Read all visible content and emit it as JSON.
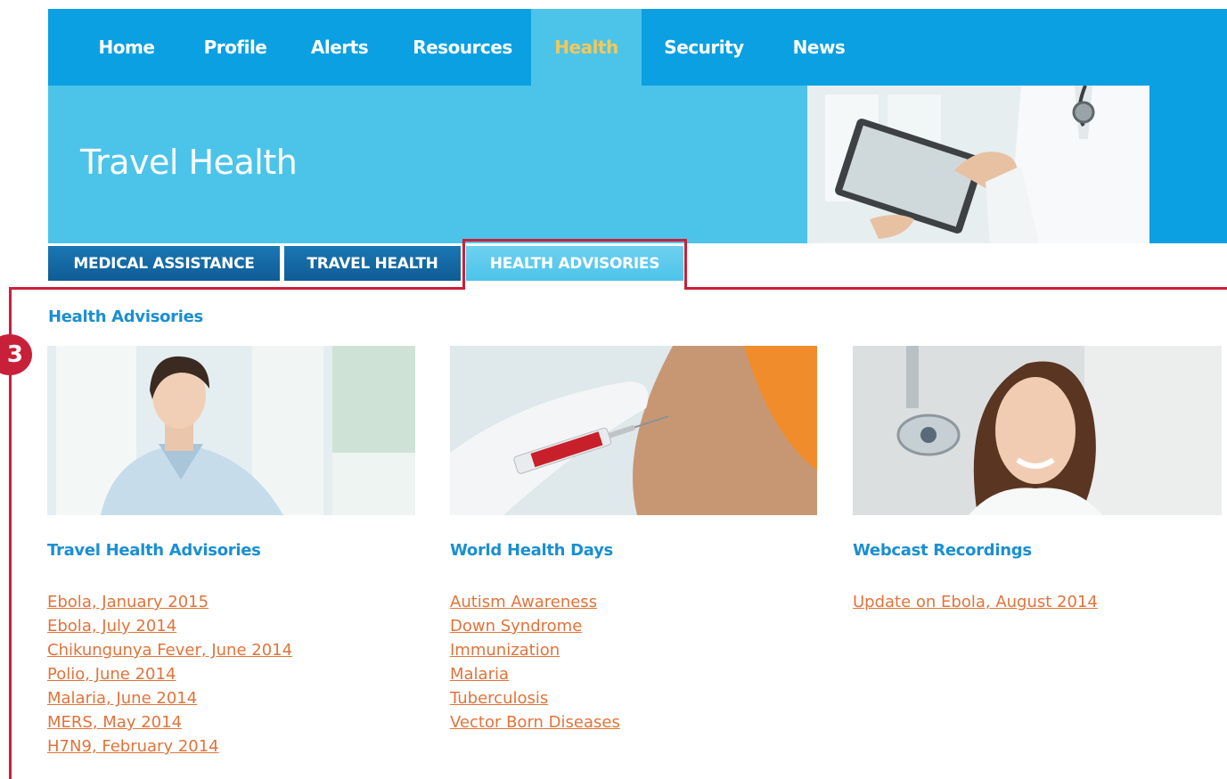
{
  "nav": {
    "items": [
      "Home",
      "Profile",
      "Alerts",
      "Resources",
      "Health",
      "Security",
      "News"
    ],
    "active": "Health"
  },
  "banner": {
    "title": "Travel Health"
  },
  "subtabs": [
    "MEDICAL ASSISTANCE",
    "TRAVEL HEALTH",
    "HEALTH ADVISORIES"
  ],
  "annotation": {
    "number": "3"
  },
  "page_heading": "Health Advisories",
  "columns": [
    {
      "title": "Travel Health Advisories",
      "links": [
        "Ebola, January 2015",
        "Ebola, July 2014",
        "Chikungunya Fever, June 2014",
        "Polio, June 2014",
        "Malaria, June 2014",
        "MERS, May 2014",
        "H7N9, February 2014"
      ]
    },
    {
      "title": "World Health Days",
      "links": [
        "Autism Awareness",
        "Down Syndrome",
        "Immunization",
        "Malaria",
        "Tuberculosis",
        "Vector Born Diseases"
      ]
    },
    {
      "title": "Webcast Recordings",
      "links": [
        "Update on Ebola, August 2014"
      ]
    }
  ],
  "colors": {
    "nav_blue": "#0aa0e2",
    "banner_blue": "#4cc4ea",
    "active_nav_text": "#f2c85c",
    "heading_blue": "#1a8fd1",
    "link_orange": "#e2733a",
    "annotation_red": "#c9203a"
  }
}
